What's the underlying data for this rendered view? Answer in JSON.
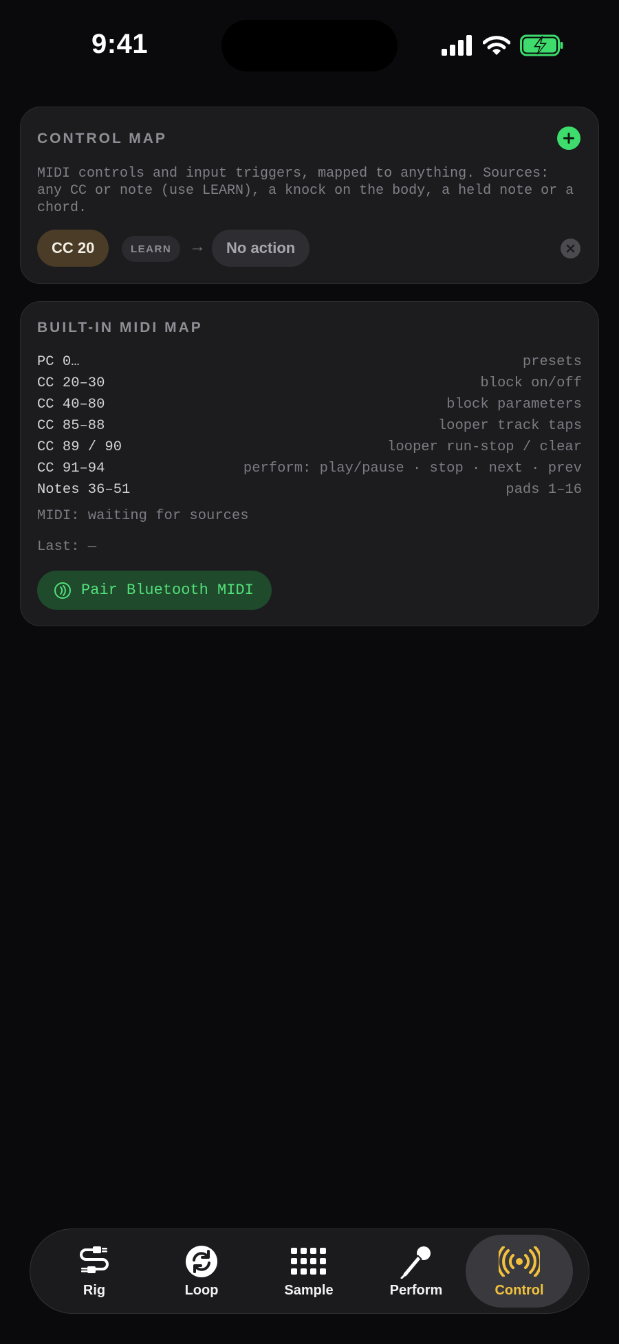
{
  "status_bar": {
    "time": "9:41"
  },
  "control_map": {
    "title": "CONTROL MAP",
    "description": "MIDI controls and input triggers, mapped to anything. Sources: any CC or note (use LEARN), a knock on the body, a held note or a chord.",
    "mapping": {
      "source": "CC 20",
      "learn_label": "LEARN",
      "arrow": "→",
      "action": "No action"
    }
  },
  "midi_map": {
    "title": "BUILT-IN MIDI MAP",
    "rows": [
      {
        "key": "PC 0…",
        "value": "presets"
      },
      {
        "key": "CC 20–30",
        "value": "block on/off"
      },
      {
        "key": "CC 40–80",
        "value": "block parameters"
      },
      {
        "key": "CC 85–88",
        "value": "looper track taps"
      },
      {
        "key": "CC 89 / 90",
        "value": "looper run-stop / clear"
      },
      {
        "key": "CC 91–94",
        "value": "perform: play/pause · stop · next · prev"
      },
      {
        "key": "Notes 36–51",
        "value": "pads 1–16"
      }
    ],
    "status": "MIDI: waiting for sources",
    "last": "Last: —",
    "pair_button": "Pair Bluetooth MIDI"
  },
  "tab_bar": {
    "tabs": [
      {
        "label": "Rig",
        "icon": "cable-icon",
        "active": false
      },
      {
        "label": "Loop",
        "icon": "loop-icon",
        "active": false
      },
      {
        "label": "Sample",
        "icon": "grid-icon",
        "active": false
      },
      {
        "label": "Perform",
        "icon": "microphone-icon",
        "active": false
      },
      {
        "label": "Control",
        "icon": "broadcast-icon",
        "active": true
      }
    ]
  },
  "colors": {
    "accent_green": "#3ddc6c",
    "active_tab": "#f2c23e",
    "background": "#0a0a0c",
    "card": "#1c1c1f"
  }
}
